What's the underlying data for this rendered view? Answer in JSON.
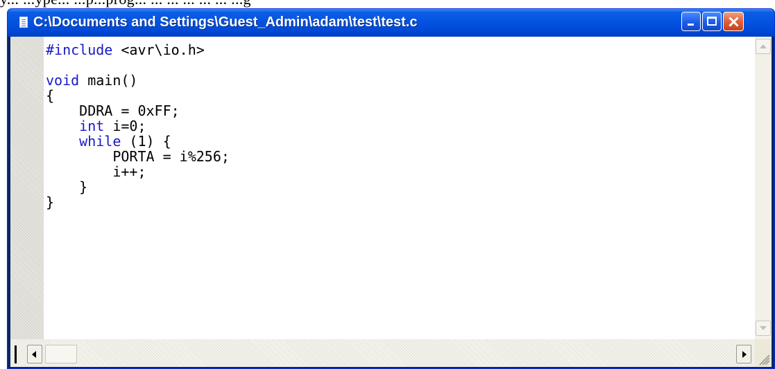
{
  "document_text": "y... ...ype... ...p...prog... ... ... ... ... ... ...g",
  "window": {
    "title": "C:\\Documents and Settings\\Guest_Admin\\adam\\test\\test.c",
    "icon": "document-icon",
    "buttons": [
      "minimize-icon",
      "maximize-icon",
      "close-icon"
    ]
  },
  "editor": {
    "lines": [
      [
        {
          "t": "#include",
          "kw": true
        },
        {
          "t": " <avr\\io.h>",
          "kw": false
        }
      ],
      [],
      [
        {
          "t": "void",
          "kw": true
        },
        {
          "t": " main()",
          "kw": false
        }
      ],
      [
        {
          "t": "{",
          "kw": false
        }
      ],
      [
        {
          "t": "    DDRA = 0xFF;",
          "kw": false
        }
      ],
      [
        {
          "t": "    ",
          "kw": false
        },
        {
          "t": "int",
          "kw": true
        },
        {
          "t": " i=0;",
          "kw": false
        }
      ],
      [
        {
          "t": "    ",
          "kw": false
        },
        {
          "t": "while",
          "kw": true
        },
        {
          "t": " (1) {",
          "kw": false
        }
      ],
      [
        {
          "t": "        PORTA = i%256;",
          "kw": false
        }
      ],
      [
        {
          "t": "        i++;",
          "kw": false
        }
      ],
      [
        {
          "t": "    }",
          "kw": false
        }
      ],
      [
        {
          "t": "}",
          "kw": false
        }
      ]
    ],
    "keyword_color": "#1919c8",
    "text_color": "#000000"
  },
  "scrollbars": {
    "vertical": [
      "scroll-up-icon",
      "scroll-down-icon"
    ],
    "horizontal": [
      "scroll-left-icon",
      "scroll-right-icon"
    ]
  }
}
